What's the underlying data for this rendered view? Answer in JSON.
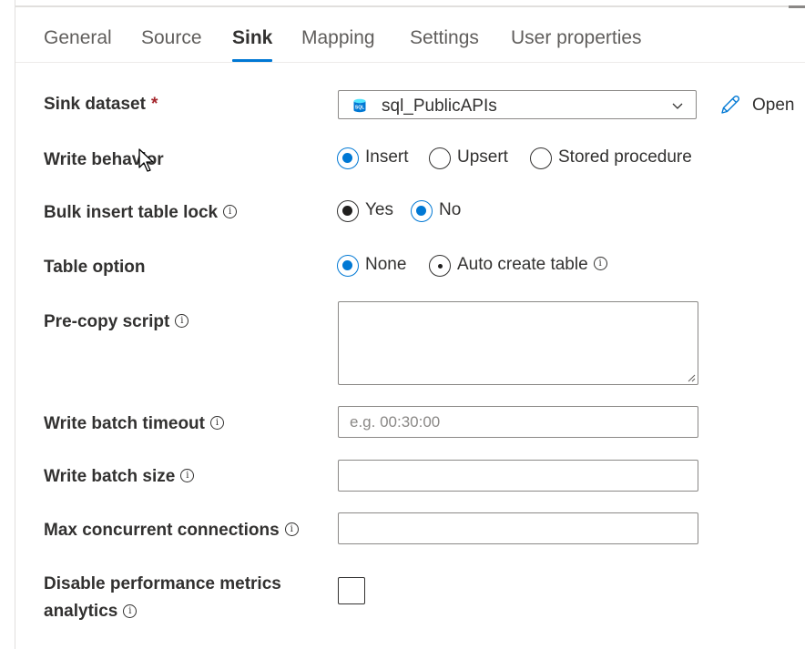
{
  "tabs": [
    "General",
    "Source",
    "Sink",
    "Mapping",
    "Settings",
    "User properties"
  ],
  "active_tab": "Sink",
  "sink_dataset": {
    "label": "Sink dataset",
    "required_mark": "*",
    "value": "sql_PublicAPIs",
    "open_label": "Open"
  },
  "write_behavior": {
    "label": "Write behavior",
    "options": [
      "Insert",
      "Upsert",
      "Stored procedure"
    ],
    "selected": "Insert"
  },
  "bulk_insert_table_lock": {
    "label": "Bulk insert table lock",
    "options": [
      "Yes",
      "No"
    ],
    "selected": "No"
  },
  "table_option": {
    "label": "Table option",
    "options": [
      "None",
      "Auto create table"
    ],
    "selected": "None"
  },
  "pre_copy_script": {
    "label": "Pre-copy script",
    "value": ""
  },
  "write_batch_timeout": {
    "label": "Write batch timeout",
    "placeholder": "e.g. 00:30:00",
    "value": ""
  },
  "write_batch_size": {
    "label": "Write batch size",
    "value": ""
  },
  "max_concurrent_connections": {
    "label": "Max concurrent connections",
    "value": ""
  },
  "disable_performance_metrics": {
    "label_line1": "Disable performance metrics",
    "label_line2": "analytics",
    "checked": false
  },
  "info_glyph": "i",
  "colors": {
    "accent": "#0078d4",
    "required": "#a4262c",
    "text": "#323130",
    "border": "#8a8886"
  }
}
